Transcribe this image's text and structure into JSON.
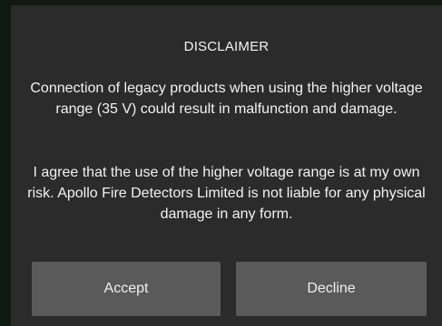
{
  "dialog": {
    "title": "DISCLAIMER",
    "message_1": "Connection of legacy products when using the higher voltage range (35 V) could result in malfunction and damage.",
    "message_2": "I agree that the use of the higher voltage range is at my own risk. Apollo Fire Detectors Limited is not liable for any physical damage in any form.",
    "accept_label": "Accept",
    "decline_label": "Decline"
  },
  "colors": {
    "dialog_background": "#2b2b2b",
    "button_background": "#5a5a5a",
    "text": "#f2f2f2"
  }
}
